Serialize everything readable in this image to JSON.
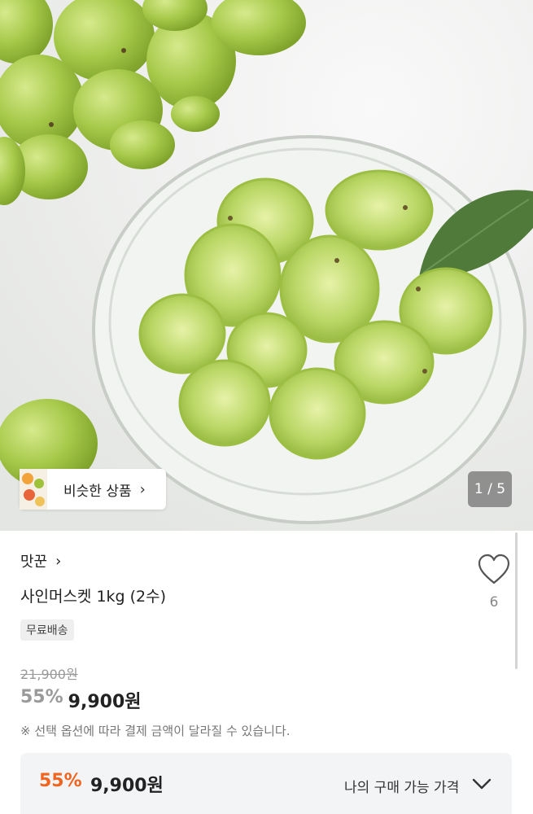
{
  "gallery": {
    "similar_products_label": "비슷한 상품",
    "image_counter": "1 / 5"
  },
  "product": {
    "brand": "맛꾼",
    "title": "사인머스켓 1kg (2수)",
    "shipping_badge": "무료배송",
    "like_count": "6",
    "original_price": "21,900원",
    "discount_percent": "55%",
    "sale_price": "9,900원",
    "notice": "※ 선택 옵션에 따라 결제 금액이 달라질 수 있습니다."
  },
  "my_price": {
    "discount_percent": "55%",
    "price": "9,900원",
    "label": "나의 구매 가능 가격"
  },
  "colors": {
    "accent": "#f2641e",
    "grape": "#9fc23a",
    "text": "#222222"
  },
  "icons": [
    "heart-outline-icon",
    "chevron-right-icon",
    "chevron-down-icon"
  ]
}
